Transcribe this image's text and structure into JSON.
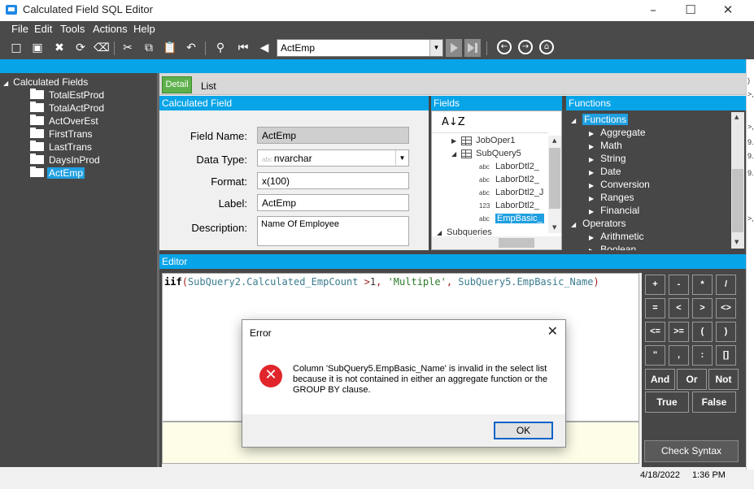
{
  "window": {
    "title": "Calculated Field SQL Editor",
    "minimize": "–",
    "maximize": "☐",
    "close": "✕"
  },
  "menu": [
    "File",
    "Edit",
    "Tools",
    "Actions",
    "Help"
  ],
  "toolbar": {
    "icons": [
      "new-icon",
      "save-icon",
      "delete-icon",
      "refresh-icon",
      "clear-icon",
      "cut-icon",
      "copy-icon",
      "paste-icon",
      "undo-icon",
      "search-icon",
      "first-record-icon",
      "previous-record-icon"
    ],
    "record_combo_value": "ActEmp"
  },
  "tree": {
    "root_label": "Calculated Fields",
    "items": [
      {
        "label": "TotalEstProd",
        "selected": false
      },
      {
        "label": "TotalActProd",
        "selected": false
      },
      {
        "label": "ActOverEst",
        "selected": false
      },
      {
        "label": "FirstTrans",
        "selected": false
      },
      {
        "label": "LastTrans",
        "selected": false
      },
      {
        "label": "DaysInProd",
        "selected": false
      },
      {
        "label": "ActEmp",
        "selected": true
      }
    ]
  },
  "tabs": {
    "detail": "Detail",
    "list": "List"
  },
  "calculated_field": {
    "header": "Calculated Field",
    "field_name_label": "Field Name:",
    "field_name_value": "ActEmp",
    "data_type_label": "Data Type:",
    "data_type_tag": "abc",
    "data_type_value": "nvarchar",
    "format_label": "Format:",
    "format_value": "x(100)",
    "label_label": "Label:",
    "label_value": "ActEmp",
    "description_label": "Description:",
    "description_value": "Name Of Employee"
  },
  "fields": {
    "header": "Fields",
    "sort_icon": "A↓Z",
    "rows": [
      {
        "kind": "table",
        "name": "JobOper1",
        "indent": 1,
        "selected": false
      },
      {
        "kind": "table-open",
        "name": "SubQuery5",
        "indent": 1,
        "selected": false
      },
      {
        "kind": "field",
        "type": "abc",
        "name": "LaborDtl2_",
        "selected": false
      },
      {
        "kind": "field",
        "type": "abc",
        "name": "LaborDtl2_",
        "selected": false
      },
      {
        "kind": "field",
        "type": "abc",
        "name": "LaborDtl2_J",
        "selected": false
      },
      {
        "kind": "field",
        "type": "123",
        "name": "LaborDtl2_",
        "selected": false
      },
      {
        "kind": "field",
        "type": "abc",
        "name": "EmpBasic_",
        "selected": true
      },
      {
        "kind": "group",
        "name": "Subqueries",
        "indent": 0,
        "selected": false
      }
    ]
  },
  "functions": {
    "header": "Functions",
    "rows": [
      {
        "name": "Functions",
        "expanded": true,
        "indent": 0,
        "selected": true
      },
      {
        "name": "Aggregate",
        "expanded": false,
        "indent": 1,
        "selected": false
      },
      {
        "name": "Math",
        "expanded": false,
        "indent": 1,
        "selected": false
      },
      {
        "name": "String",
        "expanded": false,
        "indent": 1,
        "selected": false
      },
      {
        "name": "Date",
        "expanded": false,
        "indent": 1,
        "selected": false
      },
      {
        "name": "Conversion",
        "expanded": false,
        "indent": 1,
        "selected": false
      },
      {
        "name": "Ranges",
        "expanded": false,
        "indent": 1,
        "selected": false
      },
      {
        "name": "Financial",
        "expanded": false,
        "indent": 1,
        "selected": false
      },
      {
        "name": "Operators",
        "expanded": true,
        "indent": 0,
        "selected": false
      },
      {
        "name": "Arithmetic",
        "expanded": false,
        "indent": 1,
        "selected": false
      },
      {
        "name": "Boolean",
        "expanded": false,
        "indent": 1,
        "selected": false
      }
    ]
  },
  "editor": {
    "header": "Editor",
    "code_tokens": [
      {
        "cls": "kw",
        "text": "iif"
      },
      {
        "cls": "p",
        "text": "("
      },
      {
        "cls": "id",
        "text": "SubQuery2.Calculated_EmpCount"
      },
      {
        "cls": "op",
        "text": " >"
      },
      {
        "cls": "num",
        "text": "1"
      },
      {
        "cls": "p",
        "text": ", "
      },
      {
        "cls": "str",
        "text": "'Multiple'"
      },
      {
        "cls": "p",
        "text": ", "
      },
      {
        "cls": "id",
        "text": "SubQuery5.EmpBasic_Name"
      },
      {
        "cls": "p",
        "text": ")"
      }
    ]
  },
  "calculator": {
    "ops": [
      "+",
      "-",
      "*",
      "/",
      "=",
      "<",
      ">",
      "<>",
      "<=",
      ">=",
      "(",
      ")",
      "\"",
      ",",
      ":",
      "[]"
    ],
    "logic": [
      "And",
      "Or",
      "Not",
      "True",
      "False"
    ],
    "check_syntax": "Check Syntax"
  },
  "status": {
    "date": "4/18/2022",
    "time": "1:36 PM"
  },
  "dialog": {
    "title": "Error",
    "close": "✕",
    "icon": "error-icon",
    "message": "Column 'SubQuery5.EmpBasic_Name' is invalid in the select list because it is not contained in either an aggregate function or the GROUP BY clause.",
    "ok": "OK"
  },
  "right_strip": [
    ")",
    ">,",
    ">,",
    "9.",
    "9.",
    "9.",
    ">,"
  ],
  "colors": {
    "accent": "#08a4e8",
    "dark_panel": "#474747",
    "detail_tab": "#5db04a",
    "error": "#e0262b",
    "selection": "#1f9fe0"
  }
}
